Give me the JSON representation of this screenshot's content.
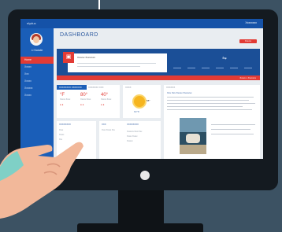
{
  "header": {
    "logo_text": "nlyduc",
    "user_label": "Xxxxxxxx"
  },
  "sidebar": {
    "username": "Li Natalie",
    "items": [
      {
        "label": "Home",
        "active": true
      },
      {
        "label": "Xxxxx",
        "active": false
      },
      {
        "label": "Xxx",
        "active": false
      },
      {
        "label": "Xxxxx",
        "active": false
      },
      {
        "label": "Xxxxxx",
        "active": false
      },
      {
        "label": "Xxxxx",
        "active": false
      }
    ]
  },
  "page": {
    "title": "DASHBOARD",
    "action_label": "Xxxxxx"
  },
  "banner": {
    "card_title": "Xxxxxx Xxxxxxxx",
    "footer_label": "Xxxxx x Xxxxxxx",
    "rss_icon": "rss-icon"
  },
  "weather_card": {
    "tab_active": "XXXXXXXX XXXXXXX",
    "tab_inactive": "XXXXXXX XXX",
    "columns": [
      {
        "temp": "°F",
        "label": "Xxxxx Xxxx"
      },
      {
        "temp": "80°",
        "label": "Xxxxx Xxxx"
      },
      {
        "temp": "40°",
        "label": "Xxxxx Xxxx"
      }
    ]
  },
  "sun_card": {
    "header": "XXXX",
    "temp": "58°",
    "label": "Xx°X",
    "icon": "sun-icon"
  },
  "news_card": {
    "header": "XXXXXX",
    "headline": "Xxx Xxx Xxxxx Xxxxxxx"
  },
  "bottom_cards": [
    {
      "header": "XXXXXXXX",
      "rows": [
        "Xxxx",
        "Xxxxx",
        "Xxx"
      ]
    },
    {
      "header": "XXX",
      "rows": [
        "Xxxx Xxxxx Xxx"
      ]
    },
    {
      "header": "XXXXXXXX",
      "rows": [
        "Xxxxxxx Xxxx Xxx",
        "Xxxxx Xxxxx",
        "Xxxxxx"
      ]
    }
  ]
}
